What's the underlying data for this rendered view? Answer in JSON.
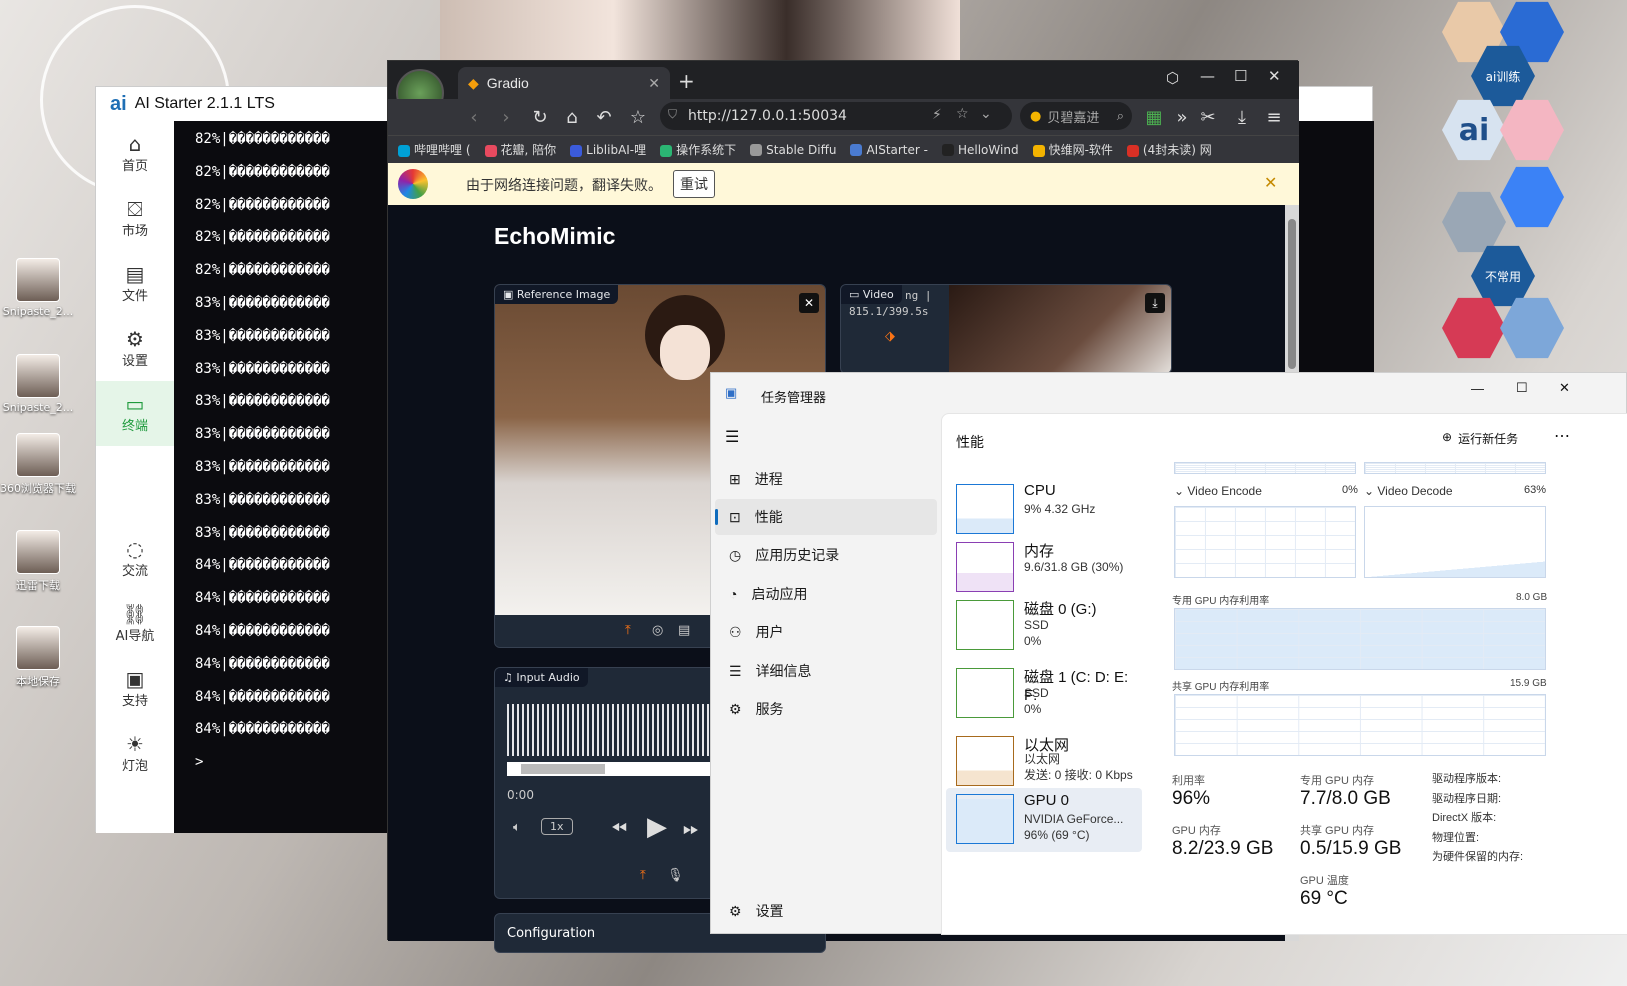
{
  "desktop": {
    "icons": [
      {
        "label": "Snipaste_2..."
      },
      {
        "label": "Snipaste_2..."
      },
      {
        "label": "360浏览器下载"
      },
      {
        "label": "迅雷下载"
      },
      {
        "label": "本地保存"
      }
    ],
    "hex_dock": {
      "ai_train": "ai训练",
      "rare": "不常用"
    }
  },
  "aistarter": {
    "title": "AI Starter 2.1.1 LTS",
    "logo": "ai",
    "nav": [
      {
        "label": "首页",
        "icon": "home-icon"
      },
      {
        "label": "市场",
        "icon": "store-icon"
      },
      {
        "label": "文件",
        "icon": "files-icon"
      },
      {
        "label": "设置",
        "icon": "gear-icon"
      },
      {
        "label": "终端",
        "icon": "terminal-icon"
      },
      {
        "label": "交流",
        "icon": "chat-icon"
      },
      {
        "label": "AI导航",
        "icon": "link-icon"
      },
      {
        "label": "支持",
        "icon": "support-icon"
      },
      {
        "label": "灯泡",
        "icon": "bulb-icon"
      }
    ],
    "terminal_lines": [
      "82%|������������",
      "82%|������������",
      "82%|������������",
      "82%|������������",
      "82%|������������",
      "83%|������������",
      "83%|������������",
      "83%|������������",
      "83%|������������",
      "83%|������������",
      "83%|������������",
      "83%|������������",
      "83%|������������",
      "84%|������������",
      "84%|������������",
      "84%|������������",
      "84%|������������",
      "84%|������������",
      "84%|������������"
    ],
    "prompt": ">"
  },
  "browser": {
    "tab_title": "Gradio",
    "url": "http://127.0.0.1:50034",
    "search_placeholder": "贝碧嘉进",
    "bookmarks": [
      "哔哩哔哩 (",
      "花瓣, 陪你",
      "LiblibAI-哩",
      "操作系统下",
      "Stable Diffu",
      "AIStarter -",
      "HelloWind",
      "快维网-软件",
      "(4封未读) 网"
    ],
    "bookmark_colors": [
      "#00a1d6",
      "#e84a5f",
      "#3b5bdb",
      "#2bb673",
      "#999999",
      "#4a7bd0",
      "#222222",
      "#f4b400",
      "#d93025"
    ],
    "translate_msg": "由于网络连接问题，翻译失败。",
    "retry": "重试"
  },
  "gradio": {
    "title": "EchoMimic",
    "reference_label": "Reference Image",
    "video_label": "Video",
    "video_progress_text": "ng |",
    "video_progress_time": "815.1/399.5s",
    "input_audio_label": "Input Audio",
    "audio_time": "0:00",
    "speed": "1x",
    "config_label": "Configuration"
  },
  "taskmgr": {
    "title": "任务管理器",
    "nav": [
      {
        "label": "进程",
        "icon": "processes-icon"
      },
      {
        "label": "性能",
        "icon": "performance-icon"
      },
      {
        "label": "应用历史记录",
        "icon": "history-icon"
      },
      {
        "label": "启动应用",
        "icon": "startup-icon"
      },
      {
        "label": "用户",
        "icon": "users-icon"
      },
      {
        "label": "详细信息",
        "icon": "details-icon"
      },
      {
        "label": "服务",
        "icon": "services-icon"
      }
    ],
    "settings": "设置",
    "header": "性能",
    "run_task": "运行新任务",
    "perf_items": [
      {
        "name": "CPU",
        "l1": "9% 4.32 GHz",
        "l2": "",
        "l3": ""
      },
      {
        "name": "内存",
        "l1": "9.6/31.8 GB (30%)",
        "l2": "",
        "l3": ""
      },
      {
        "name": "磁盘 0 (G:)",
        "l1": "SSD",
        "l2": "0%",
        "l3": ""
      },
      {
        "name": "磁盘 1 (C: D: E: F:",
        "l1": "SSD",
        "l2": "0%",
        "l3": ""
      },
      {
        "name": "以太网",
        "l1": "以太网",
        "l2": "发送: 0 接收: 0 Kbps",
        "l3": ""
      },
      {
        "name": "GPU 0",
        "l1": "NVIDIA GeForce...",
        "l2": "96% (69 °C)",
        "l3": ""
      }
    ],
    "gpu": {
      "video_encode": "Video Encode",
      "video_encode_pct": "0%",
      "video_decode": "Video Decode",
      "video_decode_pct": "63%",
      "dedicated_mem_label": "专用 GPU 内存利用率",
      "dedicated_mem_max": "8.0 GB",
      "shared_mem_label": "共享 GPU 内存利用率",
      "shared_mem_max": "15.9 GB",
      "util_label": "利用率",
      "util_value": "96%",
      "ded_label": "专用 GPU 内存",
      "ded_value": "7.7/8.0 GB",
      "gpu_mem_label": "GPU 内存",
      "gpu_mem_value": "8.2/23.9 GB",
      "shared_label": "共享 GPU 内存",
      "shared_value": "0.5/15.9 GB",
      "temp_label": "GPU 温度",
      "temp_value": "69 °C",
      "info": [
        "驱动程序版本:",
        "驱动程序日期:",
        "DirectX 版本:",
        "物理位置:",
        "为硬件保留的内存:"
      ]
    }
  }
}
